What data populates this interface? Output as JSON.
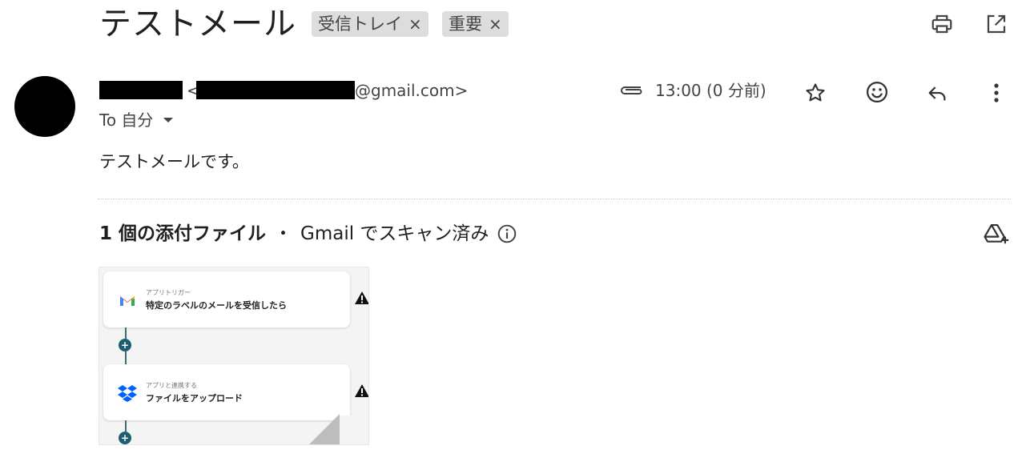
{
  "header": {
    "subject": "テストメール",
    "labels": [
      {
        "label": "受信トレイ",
        "close": "×"
      },
      {
        "label": "重要",
        "close": "×"
      }
    ],
    "print_icon": "print-icon",
    "open_in_new_icon": "open-in-new-icon"
  },
  "message": {
    "sender_email_prefix": "<",
    "sender_email_suffix": "@gmail.com>",
    "time": "13:00 (0 分前)",
    "to_label": "To 自分",
    "body": "テストメールです。"
  },
  "attachments": {
    "count_label": "1 個の添付ファイル",
    "separator": "・",
    "scan_label": "Gmail でスキャン済み",
    "thumbnail": {
      "card1_small": "アプリトリガー",
      "card1_main": "特定のラベルのメールを受信したら",
      "card2_small": "アプリと連携する",
      "card2_main": "ファイルをアップロード"
    }
  },
  "colors": {
    "chip_bg": "#dddddd",
    "text_primary": "#1f1f1f",
    "text_secondary": "#444444"
  }
}
